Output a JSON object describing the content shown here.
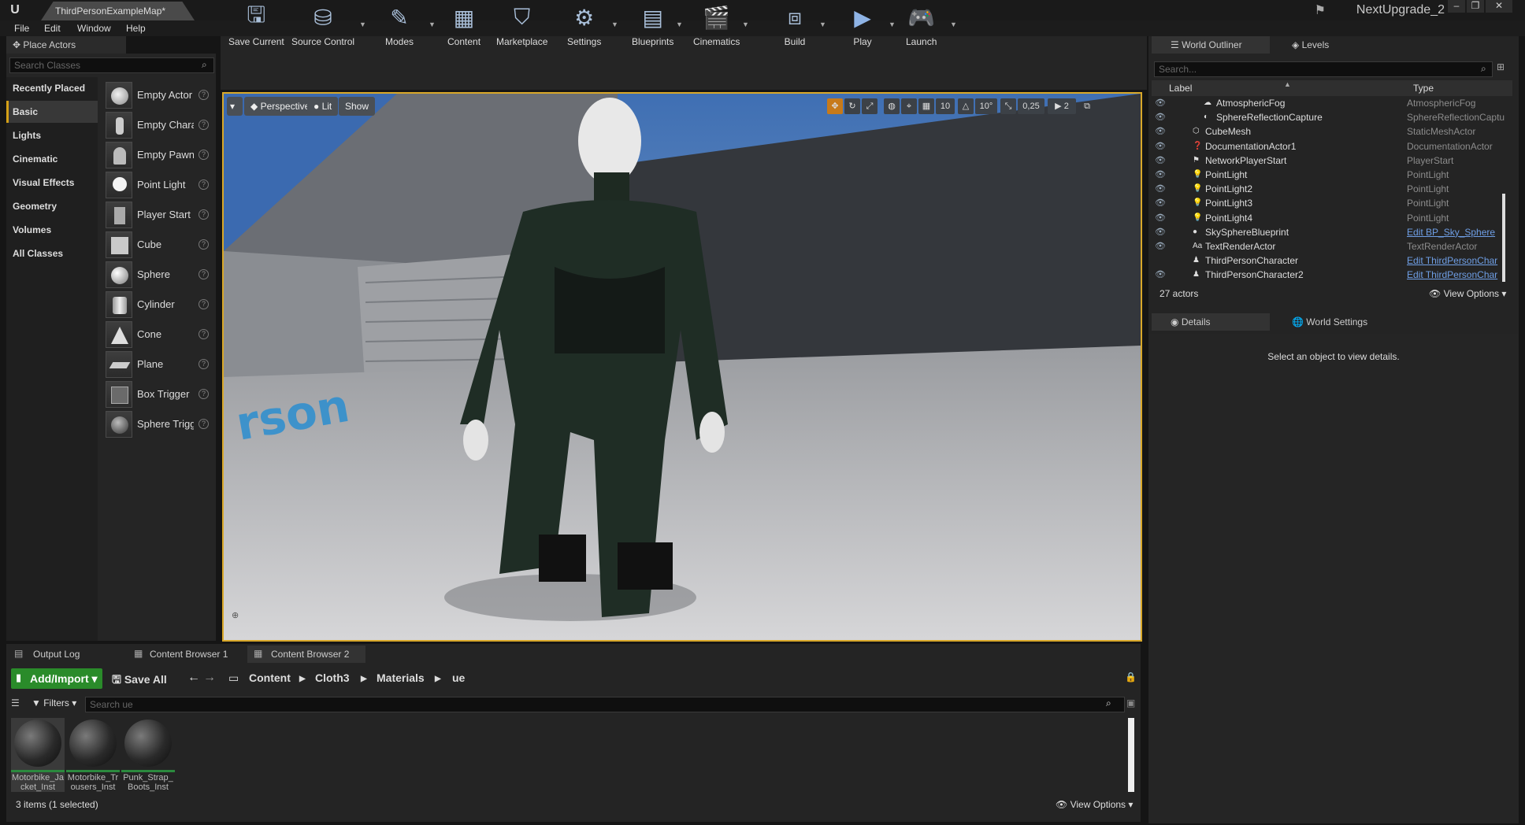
{
  "window": {
    "doc_tab": "ThirdPersonExampleMap*",
    "project": "NextUpgrade_2"
  },
  "menu": [
    "File",
    "Edit",
    "Window",
    "Help"
  ],
  "place_actors": {
    "tab": "Place Actors",
    "search_placeholder": "Search Classes",
    "categories": [
      "Recently Placed",
      "Basic",
      "Lights",
      "Cinematic",
      "Visual Effects",
      "Geometry",
      "Volumes",
      "All Classes"
    ],
    "selected_category": "Basic",
    "items": [
      "Empty Actor",
      "Empty Chara",
      "Empty Pawn",
      "Point Light",
      "Player Start",
      "Cube",
      "Sphere",
      "Cylinder",
      "Cone",
      "Plane",
      "Box Trigger",
      "Sphere Trigg"
    ]
  },
  "toolbar": [
    "Save Current",
    "Source Control",
    "Modes",
    "Content",
    "Marketplace",
    "Settings",
    "Blueprints",
    "Cinematics",
    "Build",
    "Play",
    "Launch"
  ],
  "viewport": {
    "perspective": "Perspective",
    "lit": "Lit",
    "show": "Show",
    "grid_snap": "10",
    "rot_snap": "10°",
    "scale_snap": "0,25",
    "cam_speed": "2"
  },
  "outliner": {
    "tabs": [
      "World Outliner",
      "Levels"
    ],
    "search_placeholder": "Search...",
    "col_label": "Label",
    "col_type": "Type",
    "rows": [
      {
        "label": "AtmosphericFog",
        "type": "AtmosphericFog",
        "link": false,
        "indent": 2,
        "icon": "fog-icon"
      },
      {
        "label": "SphereReflectionCapture",
        "type": "SphereReflectionCaptu",
        "link": false,
        "indent": 2,
        "icon": "reflection-icon"
      },
      {
        "label": "CubeMesh",
        "type": "StaticMeshActor",
        "link": false,
        "indent": 1,
        "icon": "mesh-icon"
      },
      {
        "label": "DocumentationActor1",
        "type": "DocumentationActor",
        "link": false,
        "indent": 1,
        "icon": "doc-icon"
      },
      {
        "label": "NetworkPlayerStart",
        "type": "PlayerStart",
        "link": false,
        "indent": 1,
        "icon": "flag-icon"
      },
      {
        "label": "PointLight",
        "type": "PointLight",
        "link": false,
        "indent": 1,
        "icon": "light-icon"
      },
      {
        "label": "PointLight2",
        "type": "PointLight",
        "link": false,
        "indent": 1,
        "icon": "light-icon"
      },
      {
        "label": "PointLight3",
        "type": "PointLight",
        "link": false,
        "indent": 1,
        "icon": "light-icon"
      },
      {
        "label": "PointLight4",
        "type": "PointLight",
        "link": false,
        "indent": 1,
        "icon": "light-icon"
      },
      {
        "label": "SkySphereBlueprint",
        "type": "Edit BP_Sky_Sphere",
        "link": true,
        "indent": 1,
        "icon": "sphere-icon"
      },
      {
        "label": "TextRenderActor",
        "type": "TextRenderActor",
        "link": false,
        "indent": 1,
        "icon": "text-icon"
      },
      {
        "label": "ThirdPersonCharacter",
        "type": "Edit ThirdPersonChar",
        "link": true,
        "indent": 1,
        "icon": "pawn-icon"
      },
      {
        "label": "ThirdPersonCharacter2",
        "type": "Edit ThirdPersonChar",
        "link": true,
        "indent": 1,
        "icon": "pawn-icon"
      }
    ],
    "count": "27 actors",
    "view_options": "View Options"
  },
  "details": {
    "tabs": [
      "Details",
      "World Settings"
    ],
    "empty": "Select an object to view details."
  },
  "bottom_tabs": [
    "Output Log",
    "Content Browser 1",
    "Content Browser 2"
  ],
  "content_browser": {
    "add_import": "Add/Import",
    "save_all": "Save All",
    "path": [
      "Content",
      "Cloth3",
      "Materials",
      "ue"
    ],
    "filters": "Filters",
    "search_placeholder": "Search ue",
    "assets": [
      "Motorbike_Jacket_Inst",
      "Motorbike_Trousers_Inst",
      "Punk_Strap_Boots_Inst"
    ],
    "status": "3 items (1 selected)",
    "view_options": "View Options"
  },
  "colors": {
    "accent": "#d9a829",
    "add_button": "#2a8b2a",
    "link": "#6f9fe6"
  }
}
